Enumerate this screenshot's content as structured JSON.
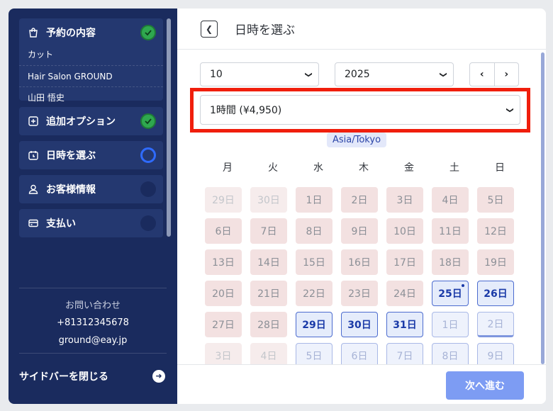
{
  "sidebar": {
    "summary": {
      "label": "予約の内容",
      "lines": [
        "カット",
        "Hair Salon GROUND",
        "山田 悟史"
      ]
    },
    "steps": [
      {
        "label": "追加オプション",
        "status": "done",
        "icon": "plus-square-icon"
      },
      {
        "label": "日時を選ぶ",
        "status": "current",
        "icon": "calendar-clock-icon"
      },
      {
        "label": "お客様情報",
        "status": "todo",
        "icon": "person-icon"
      },
      {
        "label": "支払い",
        "status": "todo",
        "icon": "credit-card-icon"
      }
    ],
    "contact": {
      "title": "お問い合わせ",
      "phone": "+81312345678",
      "email": "ground@eay.jp"
    },
    "close_label": "サイドバーを閉じる"
  },
  "header": {
    "title": "日時を選ぶ"
  },
  "controls": {
    "month": "10",
    "year": "2025",
    "duration": "1時間 (¥4,950)",
    "timezone": "Asia/Tokyo"
  },
  "calendar": {
    "weekdays": [
      "月",
      "火",
      "水",
      "木",
      "金",
      "土",
      "日"
    ],
    "weeks": [
      [
        {
          "label": "29日",
          "state": "past-other"
        },
        {
          "label": "30日",
          "state": "past-other"
        },
        {
          "label": "1日",
          "state": "past"
        },
        {
          "label": "2日",
          "state": "past"
        },
        {
          "label": "3日",
          "state": "past"
        },
        {
          "label": "4日",
          "state": "past"
        },
        {
          "label": "5日",
          "state": "past"
        }
      ],
      [
        {
          "label": "6日",
          "state": "past"
        },
        {
          "label": "7日",
          "state": "past"
        },
        {
          "label": "8日",
          "state": "past"
        },
        {
          "label": "9日",
          "state": "past"
        },
        {
          "label": "10日",
          "state": "past"
        },
        {
          "label": "11日",
          "state": "past"
        },
        {
          "label": "12日",
          "state": "past"
        }
      ],
      [
        {
          "label": "13日",
          "state": "past"
        },
        {
          "label": "14日",
          "state": "past"
        },
        {
          "label": "15日",
          "state": "past"
        },
        {
          "label": "16日",
          "state": "past"
        },
        {
          "label": "17日",
          "state": "past"
        },
        {
          "label": "18日",
          "state": "past"
        },
        {
          "label": "19日",
          "state": "past"
        }
      ],
      [
        {
          "label": "20日",
          "state": "past"
        },
        {
          "label": "21日",
          "state": "past"
        },
        {
          "label": "22日",
          "state": "past"
        },
        {
          "label": "23日",
          "state": "past"
        },
        {
          "label": "24日",
          "state": "past"
        },
        {
          "label": "25日",
          "state": "avail",
          "today": true
        },
        {
          "label": "26日",
          "state": "avail"
        }
      ],
      [
        {
          "label": "27日",
          "state": "past"
        },
        {
          "label": "28日",
          "state": "past"
        },
        {
          "label": "29日",
          "state": "avail"
        },
        {
          "label": "30日",
          "state": "avail"
        },
        {
          "label": "31日",
          "state": "avail"
        },
        {
          "label": "1日",
          "state": "next"
        },
        {
          "label": "2日",
          "state": "next",
          "underline": true
        }
      ],
      [
        {
          "label": "3日",
          "state": "past-other"
        },
        {
          "label": "4日",
          "state": "past-other"
        },
        {
          "label": "5日",
          "state": "next"
        },
        {
          "label": "6日",
          "state": "next"
        },
        {
          "label": "7日",
          "state": "next"
        },
        {
          "label": "8日",
          "state": "next"
        },
        {
          "label": "9日",
          "state": "next"
        }
      ]
    ]
  },
  "footer": {
    "next_label": "次へ進む"
  },
  "colors": {
    "sidebar_bg": "#1a2b5e",
    "accent": "#2f6bff",
    "highlight": "#f01e0c",
    "done": "#2fa84f"
  }
}
